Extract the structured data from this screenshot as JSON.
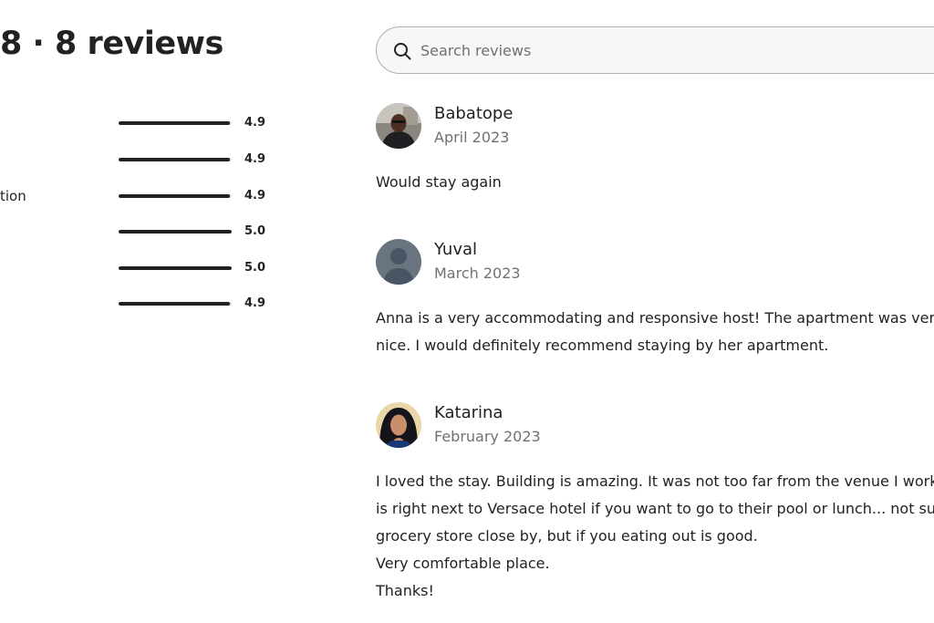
{
  "header": {
    "title": "8 · 8 reviews"
  },
  "ratings": [
    {
      "label": "",
      "value": "4.9",
      "fraction": 0.98
    },
    {
      "label": "",
      "value": "4.9",
      "fraction": 0.98
    },
    {
      "label": "tion",
      "value": "4.9",
      "fraction": 0.98
    },
    {
      "label": "",
      "value": "5.0",
      "fraction": 1.0
    },
    {
      "label": "",
      "value": "5.0",
      "fraction": 1.0
    },
    {
      "label": "",
      "value": "4.9",
      "fraction": 0.98
    }
  ],
  "search": {
    "placeholder": "Search reviews",
    "value": "",
    "icon": "search-icon"
  },
  "reviews": [
    {
      "name": "Babatope",
      "date": "April 2023",
      "text": "Would stay again",
      "avatar": "photo"
    },
    {
      "name": "Yuval",
      "date": "March 2023",
      "text": "Anna is a very accommodating and responsive host! The apartment was very\nnice. I would definitely recommend staying by her apartment.",
      "avatar": "default-user-icon"
    },
    {
      "name": "Katarina",
      "date": "February 2023",
      "text": "I loved the stay. Building is amazing. It was not too far from the venue I worked\nis right next to Versace hotel if you want to go to their pool or lunch... not sure\ngrocery store close by, but if you eating out is good.\nVery comfortable place.\nThanks!",
      "avatar": "photo"
    }
  ],
  "colors": {
    "text": "#222222",
    "muted": "#717171",
    "bar": "#222222",
    "search_bg": "#f7f7f7",
    "search_border": "#b0b0b0"
  }
}
